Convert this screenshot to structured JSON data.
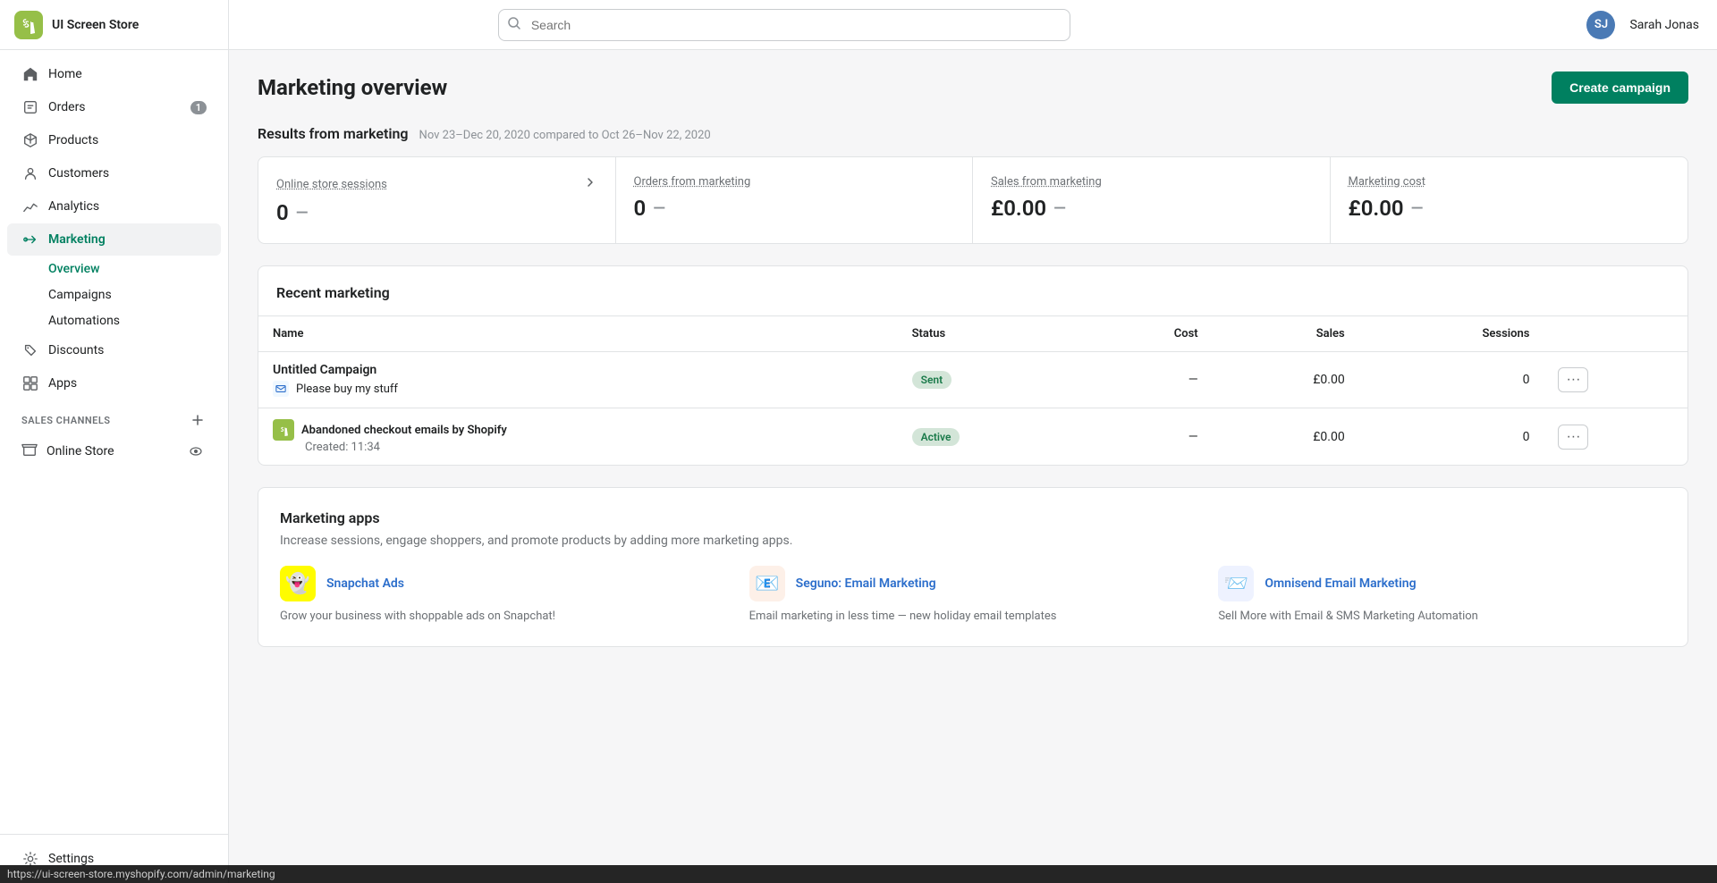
{
  "sidebar": {
    "store_name": "UI Screen Store",
    "nav_items": [
      {
        "id": "home",
        "label": "Home",
        "icon": "home"
      },
      {
        "id": "orders",
        "label": "Orders",
        "icon": "orders",
        "badge": "1"
      },
      {
        "id": "products",
        "label": "Products",
        "icon": "products"
      },
      {
        "id": "customers",
        "label": "Customers",
        "icon": "customers"
      },
      {
        "id": "analytics",
        "label": "Analytics",
        "icon": "analytics"
      },
      {
        "id": "marketing",
        "label": "Marketing",
        "icon": "marketing",
        "active": true
      }
    ],
    "marketing_sub": [
      {
        "id": "overview",
        "label": "Overview",
        "active": true
      },
      {
        "id": "campaigns",
        "label": "Campaigns"
      },
      {
        "id": "automations",
        "label": "Automations"
      }
    ],
    "nav_items2": [
      {
        "id": "discounts",
        "label": "Discounts",
        "icon": "discounts"
      },
      {
        "id": "apps",
        "label": "Apps",
        "icon": "apps"
      }
    ],
    "sales_channels_label": "SALES CHANNELS",
    "online_store_label": "Online Store",
    "settings_label": "Settings"
  },
  "topbar": {
    "search_placeholder": "Search",
    "user_initials": "SJ",
    "user_name": "Sarah Jonas",
    "user_avatar_color": "#4a7ab5"
  },
  "page": {
    "title": "Marketing overview",
    "create_btn": "Create campaign",
    "results_section": {
      "title": "Results from marketing",
      "subtitle": "Nov 23–Dec 20, 2020 compared to Oct 26–Nov 22, 2020"
    },
    "metric_cards": [
      {
        "title": "Online store sessions",
        "value": "0",
        "dash": "—",
        "has_chevron": true
      },
      {
        "title": "Orders from marketing",
        "value": "0",
        "dash": "—"
      },
      {
        "title": "Sales from marketing",
        "value": "£0.00",
        "dash": "—"
      },
      {
        "title": "Marketing cost",
        "value": "£0.00",
        "dash": "—"
      }
    ],
    "recent_marketing": {
      "title": "Recent marketing",
      "columns": [
        "Name",
        "Status",
        "Cost",
        "Sales",
        "Sessions"
      ],
      "rows": [
        {
          "type": "campaign",
          "name": "Untitled Campaign",
          "sub_icon": "email",
          "sub_label": "Please buy my stuff",
          "status": "Sent",
          "status_class": "sent",
          "cost": "—",
          "sales": "£0.00",
          "sessions": "0"
        },
        {
          "type": "automation",
          "name": "Abandoned checkout emails by Shopify",
          "sub_label": "Created: 11:34",
          "status": "Active",
          "status_class": "active",
          "cost": "—",
          "sales": "£0.00",
          "sessions": "0"
        }
      ]
    },
    "marketing_apps": {
      "title": "Marketing apps",
      "description": "Increase sessions, engage shoppers, and promote products by adding more marketing apps.",
      "apps": [
        {
          "name": "Snapchat Ads",
          "icon_color": "#fffc00",
          "icon_bg": "#fff",
          "icon_emoji": "👻",
          "description": "Grow your business with shoppable ads on Snapchat!"
        },
        {
          "name": "Seguno: Email Marketing",
          "icon_color": "#e85d04",
          "icon_bg": "#fdf0e8",
          "icon_emoji": "📧",
          "description": "Email marketing in less time — new holiday email templates"
        },
        {
          "name": "Omnisend Email Marketing",
          "icon_color": "#3b5998",
          "icon_bg": "#eef2ff",
          "icon_emoji": "📨",
          "description": "Sell More with Email & SMS Marketing Automation"
        }
      ]
    }
  },
  "statusbar": {
    "url": "https://ui-screen-store.myshopify.com/admin/marketing"
  }
}
